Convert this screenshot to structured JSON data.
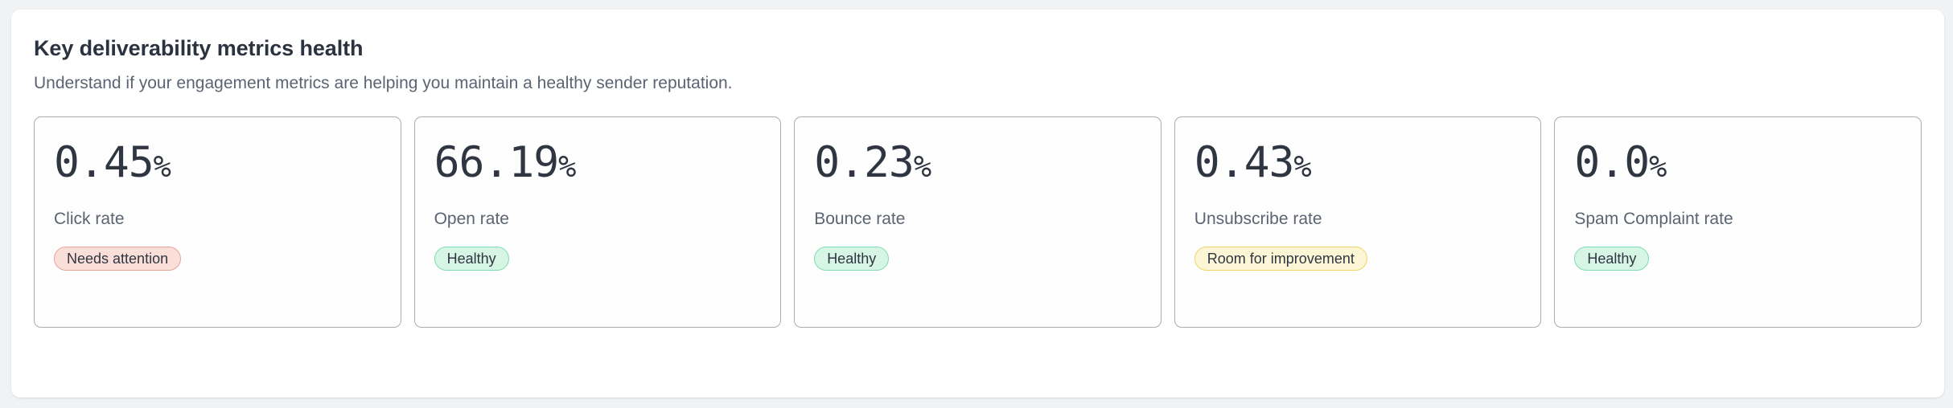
{
  "panel": {
    "title": "Key deliverability metrics health",
    "subtitle": "Understand if your engagement metrics are helping you maintain a healthy sender reputation."
  },
  "status_colors": {
    "healthy_background": "#d7f5e4",
    "healthy_border": "#7fdcb0",
    "needs_attention_background": "#fadfd9",
    "needs_attention_border": "#e7a397",
    "room_for_improvement_background": "#fcf6d6",
    "room_for_improvement_border": "#efd463"
  },
  "metrics": [
    {
      "value": "0.45",
      "unit": "%",
      "label": "Click rate",
      "status": "Needs attention",
      "status_key": "needs-attention"
    },
    {
      "value": "66.19",
      "unit": "%",
      "label": "Open rate",
      "status": "Healthy",
      "status_key": "healthy"
    },
    {
      "value": "0.23",
      "unit": "%",
      "label": "Bounce rate",
      "status": "Healthy",
      "status_key": "healthy"
    },
    {
      "value": "0.43",
      "unit": "%",
      "label": "Unsubscribe rate",
      "status": "Room for improvement",
      "status_key": "room-for-improvement"
    },
    {
      "value": "0.0",
      "unit": "%",
      "label": "Spam Complaint rate",
      "status": "Healthy",
      "status_key": "healthy"
    }
  ]
}
